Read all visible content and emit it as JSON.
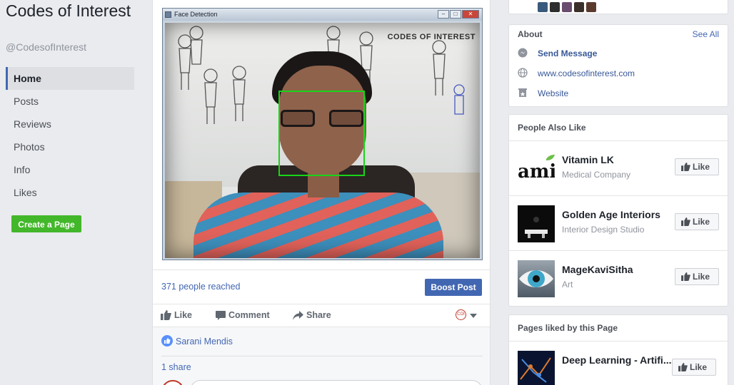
{
  "page": {
    "name": "Codes of Interest",
    "handle": "@CodesofInterest"
  },
  "nav": {
    "items": [
      {
        "label": "Home",
        "active": true
      },
      {
        "label": "Posts"
      },
      {
        "label": "Reviews"
      },
      {
        "label": "Photos"
      },
      {
        "label": "Info"
      },
      {
        "label": "Likes"
      }
    ],
    "create_page": "Create a Page"
  },
  "post": {
    "window_title": "Face Detection",
    "watermark": "CODES OF INTEREST",
    "reach_text": "371 people reached",
    "boost_label": "Boost Post",
    "actions": {
      "like": "Like",
      "comment": "Comment",
      "share": "Share"
    },
    "liked_by": "Sarani Mendis",
    "shares": "1 share"
  },
  "about": {
    "title": "About",
    "see_all": "See All",
    "send_message": "Send Message",
    "website_url": "www.codesofinterest.com",
    "website_label": "Website"
  },
  "people_also_like": {
    "title": "People Also Like",
    "items": [
      {
        "name": "Vitamin LK",
        "category": "Medical Company",
        "thumb_text": "ami"
      },
      {
        "name": "Golden Age Interiors",
        "category": "Interior Design Studio"
      },
      {
        "name": "MageKaviSitha",
        "category": "Art"
      }
    ],
    "like_label": "Like"
  },
  "pages_liked": {
    "title": "Pages liked by this Page",
    "items": [
      {
        "name": "Deep Learning - Artifi..."
      }
    ],
    "like_label": "Like"
  },
  "colors": {
    "brand_blue": "#4267b2",
    "green_button": "#42b72a",
    "detection_box": "#19d419"
  }
}
